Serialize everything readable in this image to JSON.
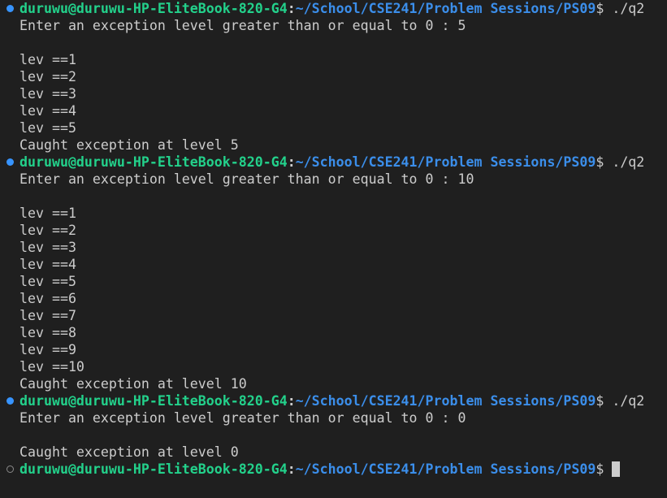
{
  "terminal": {
    "user_host": "duruwu@duruwu-HP-EliteBook-820-G4",
    "path": "~/School/CSE241/Problem Sessions/PS09",
    "dollar": "$",
    "sessions": [
      {
        "command": "./q2",
        "decoration": "success-dot-icon",
        "output": [
          "Enter an exception level greater than or equal to 0 : 5",
          "",
          "lev ==1",
          "lev ==2",
          "lev ==3",
          "lev ==4",
          "lev ==5",
          "Caught exception at level 5"
        ]
      },
      {
        "command": "./q2",
        "decoration": "success-dot-icon",
        "output": [
          "Enter an exception level greater than or equal to 0 : 10",
          "",
          "lev ==1",
          "lev ==2",
          "lev ==3",
          "lev ==4",
          "lev ==5",
          "lev ==6",
          "lev ==7",
          "lev ==8",
          "lev ==9",
          "lev ==10",
          "Caught exception at level 10"
        ]
      },
      {
        "command": "./q2",
        "decoration": "success-dot-icon",
        "output": [
          "Enter an exception level greater than or equal to 0 : 0",
          "",
          "Caught exception at level 0"
        ]
      }
    ],
    "current_prompt": {
      "command": "",
      "decoration": "empty-circle-icon"
    },
    "colors": {
      "background": "#1f1f1f",
      "user": "#23d18b",
      "path": "#3b8eea",
      "text": "#cccccc",
      "decoration_success": "#3794ff"
    }
  }
}
